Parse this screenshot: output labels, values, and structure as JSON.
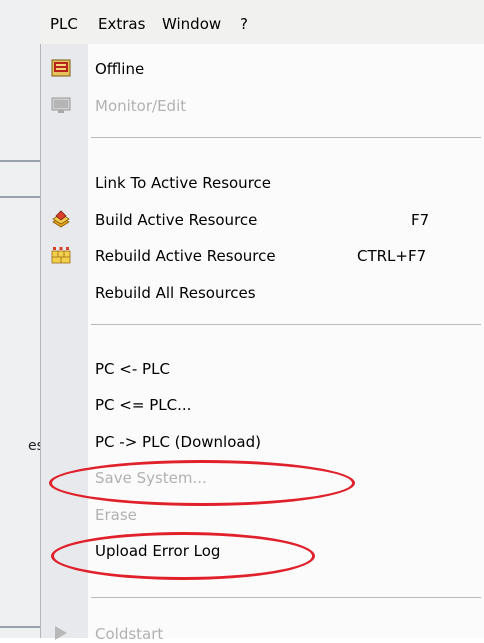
{
  "menubar": {
    "items": [
      "PLC",
      "Extras",
      "Window",
      "?"
    ]
  },
  "background": {
    "fragment_text": "es"
  },
  "menu": {
    "items": [
      {
        "label": "Offline",
        "enabled": true,
        "icon": "offline-icon"
      },
      {
        "label": "Monitor/Edit",
        "enabled": false,
        "icon": "monitor-edit-icon"
      },
      {
        "label": "Link To Active Resource",
        "enabled": true
      },
      {
        "label": "Build Active Resource",
        "enabled": true,
        "shortcut": "F7",
        "icon": "build-icon"
      },
      {
        "label": "Rebuild Active Resource",
        "enabled": true,
        "shortcut": "CTRL+F7",
        "icon": "rebuild-icon"
      },
      {
        "label": "Rebuild All Resources",
        "enabled": true
      },
      {
        "label": "PC <- PLC",
        "enabled": true
      },
      {
        "label": "PC <= PLC...",
        "enabled": true
      },
      {
        "label": "PC -> PLC (Download)",
        "enabled": true
      },
      {
        "label": "Save System...",
        "enabled": false
      },
      {
        "label": "Erase",
        "enabled": false
      },
      {
        "label": "Upload Error Log",
        "enabled": true
      },
      {
        "label": "Coldstart",
        "enabled": false,
        "icon": "coldstart-icon"
      }
    ]
  },
  "colors": {
    "highlight_circle": "#e0202a",
    "disabled_text": "#b1b1b1"
  }
}
